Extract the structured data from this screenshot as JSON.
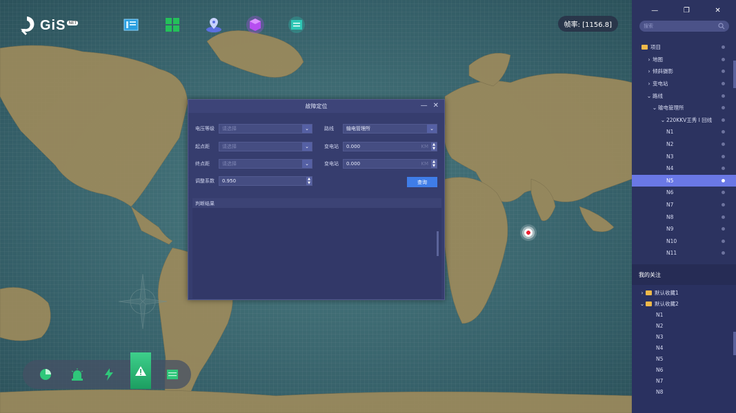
{
  "logo": {
    "text": "GiS",
    "tag": "NET"
  },
  "topbar": {
    "icons": [
      "layers-icon",
      "grid-icon",
      "location-icon",
      "cube-icon",
      "document-icon"
    ]
  },
  "fps": {
    "label": "帧率: [1156.8]"
  },
  "bottombar": {
    "icons": [
      "pie-chart-icon",
      "alarm-icon",
      "lightning-icon",
      "warning-icon",
      "table-icon"
    ],
    "active_index": 3
  },
  "dialog": {
    "title": "故障定位",
    "minimize": "—",
    "close": "✕",
    "voltage_label": "电压等级",
    "voltage_placeholder": "请选择",
    "line_label": "路线",
    "line_value": "输电管理所",
    "start_label": "起点距",
    "start_placeholder": "请选择",
    "sub1_label": "变电站",
    "sub1_value": "0.000",
    "sub1_unit": "KM",
    "end_label": "终点距",
    "end_placeholder": "请选择",
    "sub2_label": "变电站",
    "sub2_value": "0.000",
    "sub2_unit": "KM",
    "coef_label": "调整系数",
    "coef_value": "0.950",
    "query_button": "查询",
    "result_title": "判断结果"
  },
  "panel": {
    "search_placeholder": "搜索",
    "tree": [
      {
        "label": "项目",
        "level": 0,
        "folder": true
      },
      {
        "label": "地图",
        "level": 1,
        "caret": "›"
      },
      {
        "label": "倾斜摄影",
        "level": 1,
        "caret": "›"
      },
      {
        "label": "变电站",
        "level": 1,
        "caret": "›"
      },
      {
        "label": "路线",
        "level": 1,
        "caret": "⌄"
      },
      {
        "label": "输电管理所",
        "level": 2,
        "caret": "⌄"
      },
      {
        "label": "220KKV王秀 I 回线",
        "level": 3,
        "caret": "⌄"
      },
      {
        "label": "N1",
        "level": 4
      },
      {
        "label": "N2",
        "level": 4
      },
      {
        "label": "N3",
        "level": 4
      },
      {
        "label": "N4",
        "level": 4
      },
      {
        "label": "N5",
        "level": 4,
        "selected": true
      },
      {
        "label": "N6",
        "level": 4
      },
      {
        "label": "N7",
        "level": 4
      },
      {
        "label": "N8",
        "level": 4
      },
      {
        "label": "N9",
        "level": 4
      },
      {
        "label": "N10",
        "level": 4
      },
      {
        "label": "N11",
        "level": 4
      }
    ],
    "fav_title": "我的关注",
    "fav": [
      {
        "label": "默认收藏1",
        "folder": true,
        "caret": "›"
      },
      {
        "label": "默认收藏2",
        "folder": true,
        "caret": "⌄"
      },
      {
        "label": "N1"
      },
      {
        "label": "N2"
      },
      {
        "label": "N3"
      },
      {
        "label": "N4"
      },
      {
        "label": "N5"
      },
      {
        "label": "N6"
      },
      {
        "label": "N7"
      },
      {
        "label": "N8"
      }
    ]
  }
}
